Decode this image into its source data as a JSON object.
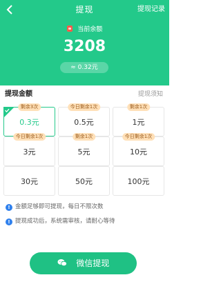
{
  "header": {
    "title": "提现",
    "record_link": "提现记录",
    "balance_label": "当前余额",
    "balance_value": "3208",
    "approx_value": "≈ 0.32元"
  },
  "section": {
    "title": "提现金额",
    "notice_link": "提现须知"
  },
  "options": [
    {
      "tag": "剩余3次",
      "amount": "0.3元",
      "selected": true
    },
    {
      "tag": "今日剩余1次",
      "amount": "0.5元",
      "selected": false
    },
    {
      "tag": "剩余1次",
      "amount": "1元",
      "selected": false
    },
    {
      "tag": "今日剩余1次",
      "amount": "3元",
      "selected": false
    },
    {
      "tag": "剩余1次",
      "amount": "5元",
      "selected": false
    },
    {
      "tag": "今日剩余1次",
      "amount": "10元",
      "selected": false
    },
    {
      "tag": "",
      "amount": "30元",
      "selected": false
    },
    {
      "tag": "",
      "amount": "50元",
      "selected": false
    },
    {
      "tag": "",
      "amount": "100元",
      "selected": false
    }
  ],
  "tips": [
    "金额足够即可提现，每日不限次数",
    "提现成功后，系统需审核，请耐心等待"
  ],
  "button": {
    "label": "微信提现"
  },
  "colors": {
    "accent": "#23c98a",
    "tag_bg": "#ffe0b8",
    "info_blue": "#2f80ed"
  },
  "icons": {
    "back": "chevron-left-icon",
    "coin": "red-coin-icon",
    "check": "check-corner-icon",
    "info": "info-icon",
    "wechat": "wechat-icon"
  }
}
